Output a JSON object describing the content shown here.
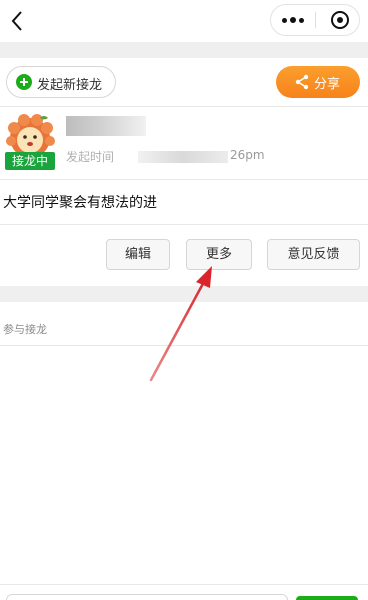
{
  "nav": {
    "back_icon": "chevron-left-icon",
    "more_icon": "more-dots-icon",
    "close_icon": "target-close-icon"
  },
  "toolbar": {
    "new_label": "发起新接龙",
    "share_label": "分享",
    "accent": "#f7891f",
    "green": "#1aad19"
  },
  "post": {
    "status_badge": "接龙中",
    "time_label": "发起时间",
    "time_visible_tail": "26pm",
    "subject": "大学同学聚会有想法的进"
  },
  "actions": {
    "edit": "编辑",
    "more": "更多",
    "feedback": "意见反馈"
  },
  "join_label": "参与接龙",
  "annotation": {
    "color": "#d8262c"
  }
}
